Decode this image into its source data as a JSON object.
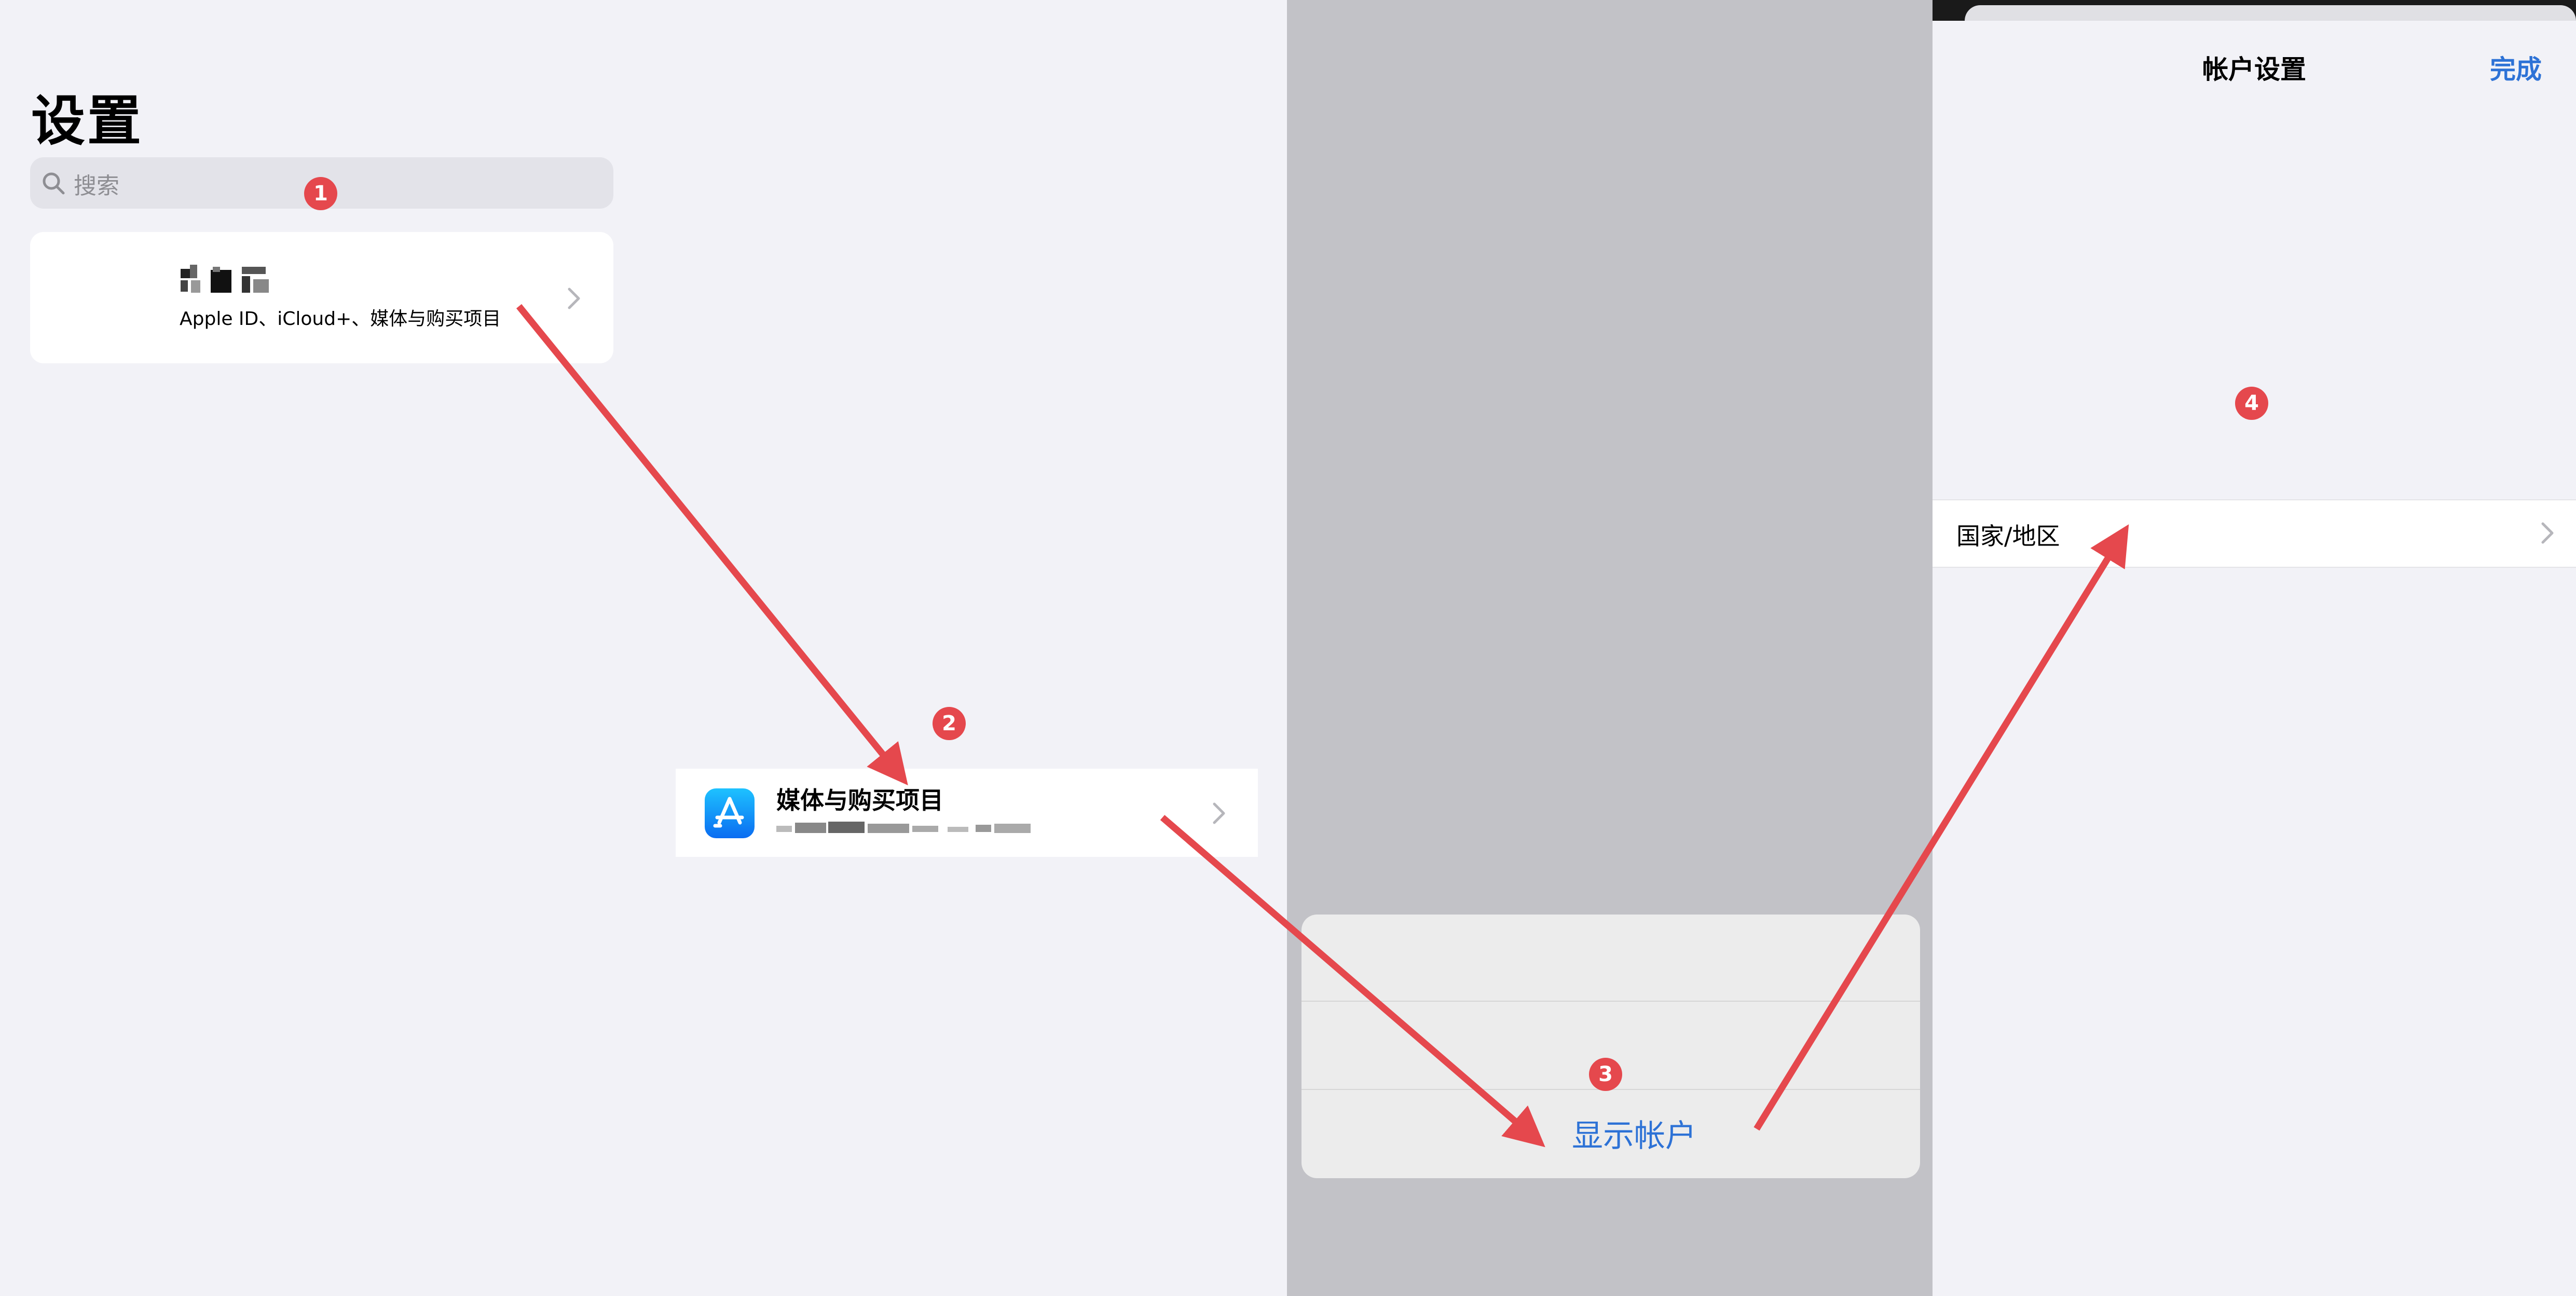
{
  "panel1": {
    "title": "设置",
    "search_placeholder": "搜索",
    "profile": {
      "subtitle": "Apple ID、iCloud+、媒体与购买项目"
    }
  },
  "panel2": {
    "media_title": "媒体与购买项目"
  },
  "panel3": {
    "show_account": "显示帐户"
  },
  "panel4": {
    "nav_title": "帐户设置",
    "done": "完成",
    "country_region": "国家/地区"
  },
  "badges": [
    "1",
    "2",
    "3",
    "4"
  ],
  "colors": {
    "accent_blue": "#2d72d6",
    "annotation_red": "#e5484d",
    "background": "#f2f2f7"
  },
  "icons": [
    "search-icon",
    "chevron-right-icon",
    "app-store-icon"
  ]
}
